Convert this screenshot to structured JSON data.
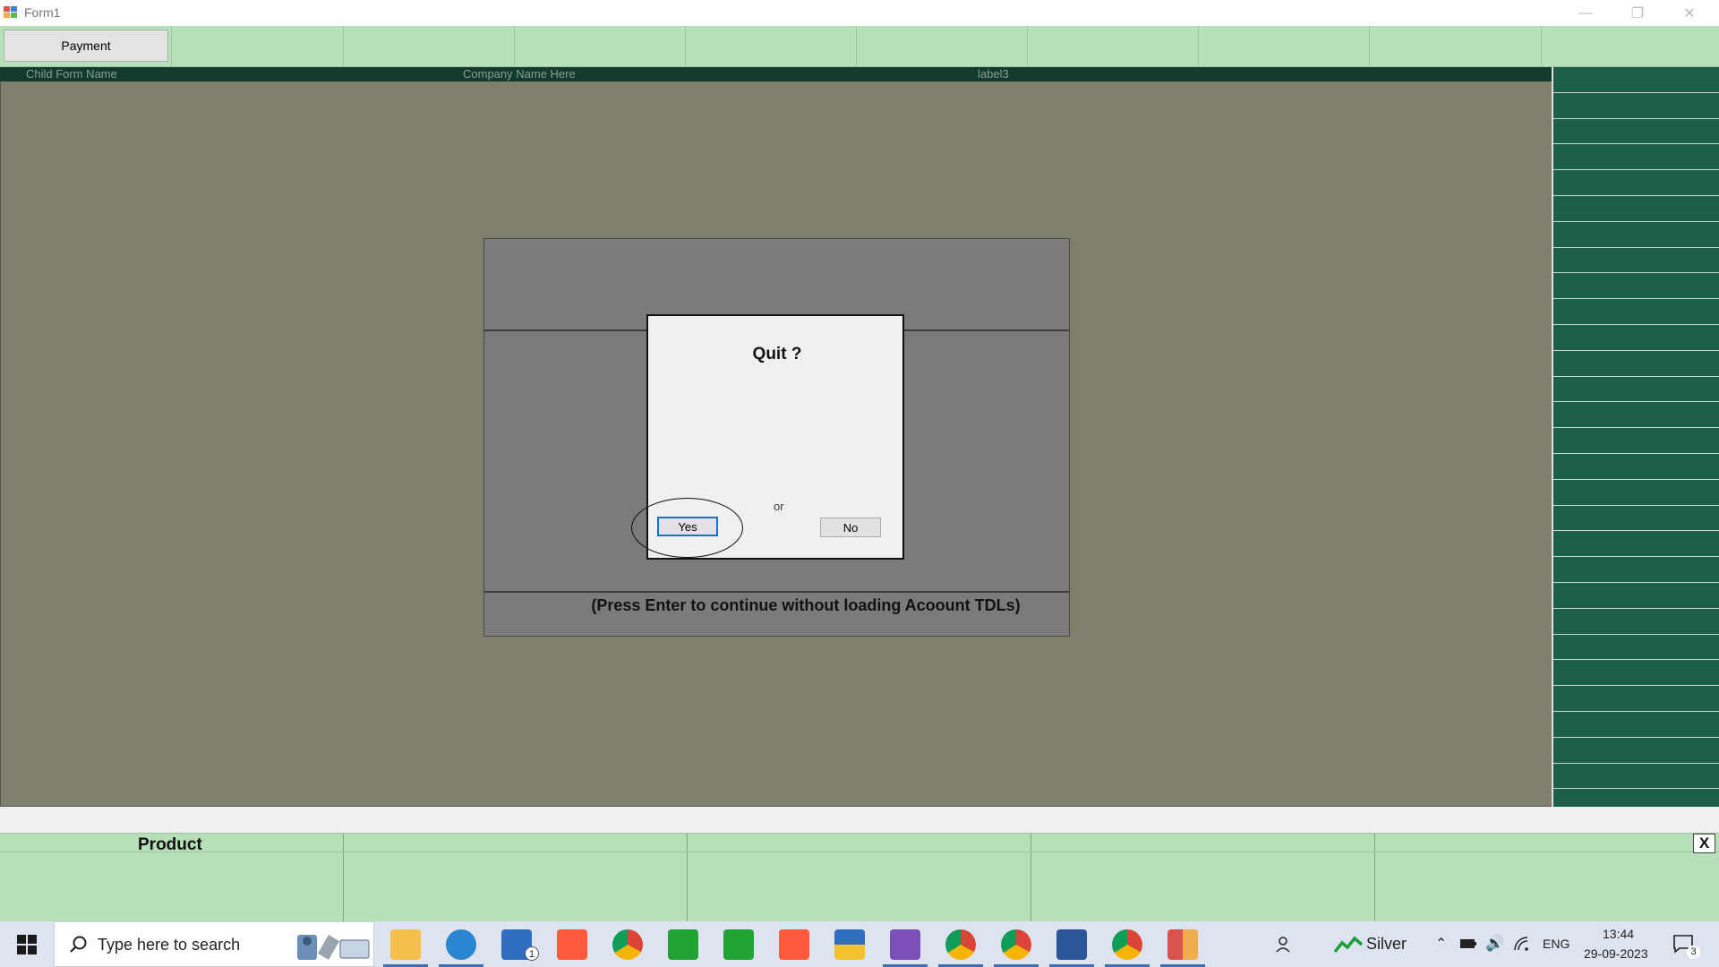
{
  "window": {
    "title": "Form1",
    "minimize_glyph": "—",
    "restore_glyph": "❐",
    "close_glyph": "✕"
  },
  "toolbar": {
    "payment_label": "Payment"
  },
  "header": {
    "child_form_name": "Child Form Name",
    "company_name": "Company Name Here",
    "label3": "label3"
  },
  "dialog": {
    "title": "Quit ?",
    "or_text": "or",
    "yes_label": "Yes",
    "no_label": "No"
  },
  "notice": {
    "press_enter": "(Press Enter to continue without loading Acoount TDLs)"
  },
  "product_grid": {
    "header": "Product",
    "close_label": "X"
  },
  "taskbar": {
    "search_placeholder": "Type here to search",
    "stock_name": "Silver",
    "language": "ENG",
    "time": "13:44",
    "date": "29-09-2023",
    "notification_count": "3",
    "mail_badge": "1"
  },
  "colors": {
    "workspace": "#807f6b",
    "header_strip": "#123a2e",
    "right_panel": "#1d5e49",
    "grid_green": "#b7dfb8",
    "panel_gray": "#7b7b7b"
  }
}
